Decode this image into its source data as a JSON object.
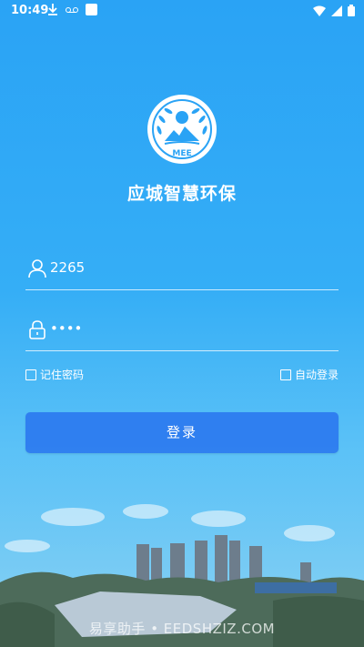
{
  "status_bar": {
    "time": "10:49",
    "icons_left": [
      "download-icon",
      "voicemail-icon",
      "notification-square-icon"
    ],
    "icons_right": [
      "wifi-icon",
      "signal-icon",
      "battery-icon"
    ]
  },
  "app": {
    "title": "应城智慧环保",
    "logo_text": "MEE"
  },
  "login": {
    "username_value": "2265",
    "password_value": "••••",
    "remember_label": "记住密码",
    "auto_login_label": "自动登录",
    "login_button": "登录"
  },
  "watermark": "易享助手 • EEDSHZIZ.COM"
}
